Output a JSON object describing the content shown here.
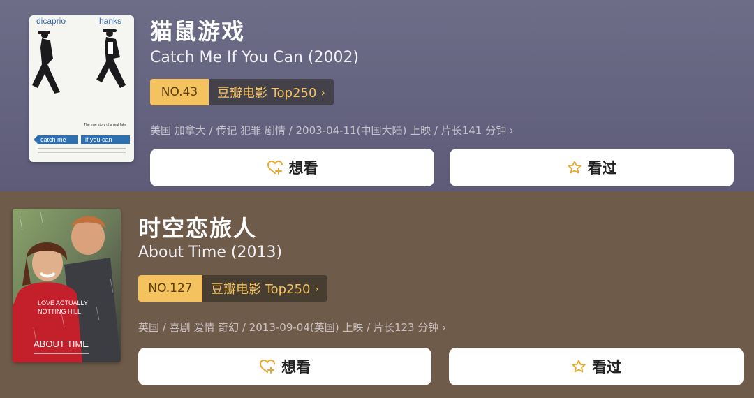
{
  "movies": [
    {
      "title": "猫鼠游戏",
      "subtitle": "Catch Me If You Can (2002)",
      "rank_no": "NO.43",
      "rank_list": "豆瓣电影 Top250",
      "meta": "美国 加拿大 / 传记 犯罪 剧情 / 2003-04-11(中国大陆) 上映 / 片长141 分钟",
      "want_label": "想看",
      "seen_label": "看过",
      "poster_text": {
        "actor_left": "dicaprio",
        "actor_right": "hanks",
        "tagline": "The true story of a real fake",
        "title_left": "catch me",
        "title_right": "if you can"
      }
    },
    {
      "title": "时空恋旅人",
      "subtitle": "About Time (2013)",
      "rank_no": "NO.127",
      "rank_list": "豆瓣电影 Top250",
      "meta": "英国 / 喜剧 爱情 奇幻 / 2013-09-04(英国) 上映 / 片长123 分钟",
      "want_label": "想看",
      "seen_label": "看过",
      "poster_text": {
        "tagline_1": "LOVE ACTUALLY",
        "tagline_2": "NOTTING HILL",
        "title": "ABOUT TIME"
      }
    }
  ],
  "colors": {
    "card1_bg": "#65647f",
    "card2_bg": "#6f5b49",
    "rank_badge": "#f4c25e",
    "button_bg": "#ffffff"
  },
  "icons": {
    "want": "heart-plus-icon",
    "seen": "star-outline-icon",
    "chevron": "chevron-right-icon"
  }
}
